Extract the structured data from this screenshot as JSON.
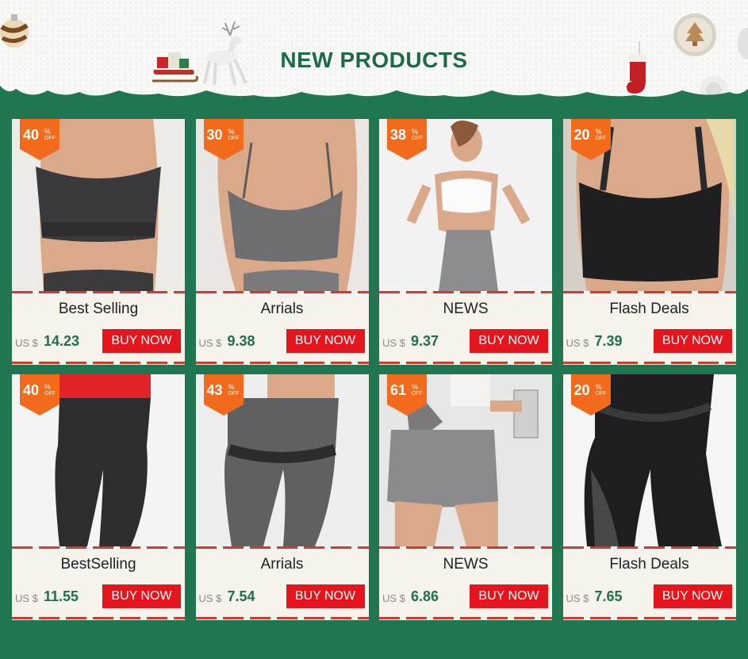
{
  "header": {
    "title": "NEW PRODUCTS"
  },
  "currency": "US $",
  "buy_label": "BUY NOW",
  "off_label": "OFF",
  "percent_symbol": "%",
  "colors": {
    "green": "#1f7650",
    "title_green": "#1d6b46",
    "red": "#e4151d",
    "badge_orange": "#f26a1b"
  },
  "products": [
    {
      "category": "Best Selling",
      "price": "14.23",
      "discount": "40",
      "item": "grey-sports-bra"
    },
    {
      "category": "Arrials",
      "price": "9.38",
      "discount": "30",
      "item": "grey-strappy-bra"
    },
    {
      "category": "NEWS",
      "price": "9.37",
      "discount": "38",
      "item": "white-bra-grey-leggings"
    },
    {
      "category": "Flash Deals",
      "price": "7.39",
      "discount": "20",
      "item": "black-mesh-bra"
    },
    {
      "category": "BestSelling",
      "price": "11.55",
      "discount": "40",
      "item": "black-leggings"
    },
    {
      "category": "Arrials",
      "price": "7.54",
      "discount": "43",
      "item": "grey-leggings"
    },
    {
      "category": "NEWS",
      "price": "6.86",
      "discount": "61",
      "item": "textured-shorts"
    },
    {
      "category": "Flash Deals",
      "price": "7.65",
      "discount": "20",
      "item": "black-mesh-leggings"
    }
  ]
}
